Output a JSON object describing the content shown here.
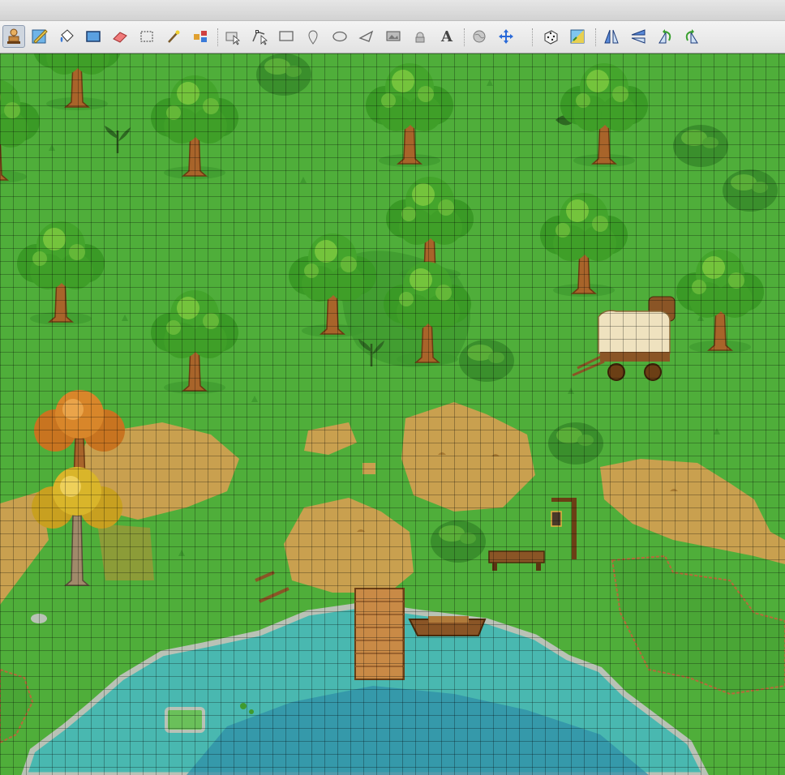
{
  "window": {
    "title": ""
  },
  "toolbar": {
    "tools": [
      {
        "id": "stamp-brush",
        "icon": "stamp-brush-icon",
        "active": true
      },
      {
        "id": "terrain-brush",
        "icon": "terrain-brush-icon"
      },
      {
        "id": "bucket-fill",
        "icon": "bucket-fill-icon"
      },
      {
        "id": "shape-fill",
        "icon": "shape-fill-icon"
      },
      {
        "id": "eraser",
        "icon": "eraser-icon"
      },
      {
        "id": "rectangular-select",
        "icon": "rectangle-select-icon"
      },
      {
        "id": "magic-wand",
        "icon": "magic-wand-icon"
      },
      {
        "id": "select-same-tile",
        "icon": "select-same-tile-icon"
      },
      {
        "id": "select-objects",
        "icon": "select-objects-icon"
      },
      {
        "id": "edit-polygons",
        "icon": "edit-polygons-icon"
      },
      {
        "id": "insert-rectangle",
        "icon": "insert-rectangle-icon"
      },
      {
        "id": "insert-point",
        "icon": "insert-point-icon"
      },
      {
        "id": "insert-ellipse",
        "icon": "insert-ellipse-icon"
      },
      {
        "id": "insert-polygon",
        "icon": "insert-polygon-icon"
      },
      {
        "id": "insert-tile",
        "icon": "insert-tile-icon"
      },
      {
        "id": "insert-template",
        "icon": "insert-template-icon"
      },
      {
        "id": "insert-text",
        "icon": "insert-text-icon",
        "glyph": "A"
      },
      {
        "id": "world-tool",
        "icon": "world-tool-icon"
      },
      {
        "id": "layer-offset",
        "icon": "layer-offset-icon"
      },
      {
        "id": "random-mode",
        "icon": "dice-icon"
      },
      {
        "id": "wang-fill-mode",
        "icon": "wang-fill-icon"
      },
      {
        "id": "flip-horizontal",
        "icon": "flip-horizontal-icon"
      },
      {
        "id": "flip-vertical",
        "icon": "flip-vertical-icon"
      },
      {
        "id": "rotate-left",
        "icon": "rotate-left-icon"
      },
      {
        "id": "rotate-right",
        "icon": "rotate-right-icon"
      }
    ]
  },
  "map": {
    "grid_visible": true,
    "colors": {
      "grass": "#4fae3a",
      "grass_dark": "#3f9a2f",
      "dirt": "#c9a04f",
      "water": "#49b8b0",
      "water_deep": "#2f8fa8",
      "stone": "#b9c2b6",
      "wood": "#b07a3a",
      "leaf": "#44a52c",
      "leaf_light": "#74c43c",
      "autumn_orange": "#d8862a",
      "autumn_yellow": "#d9b52a"
    }
  }
}
